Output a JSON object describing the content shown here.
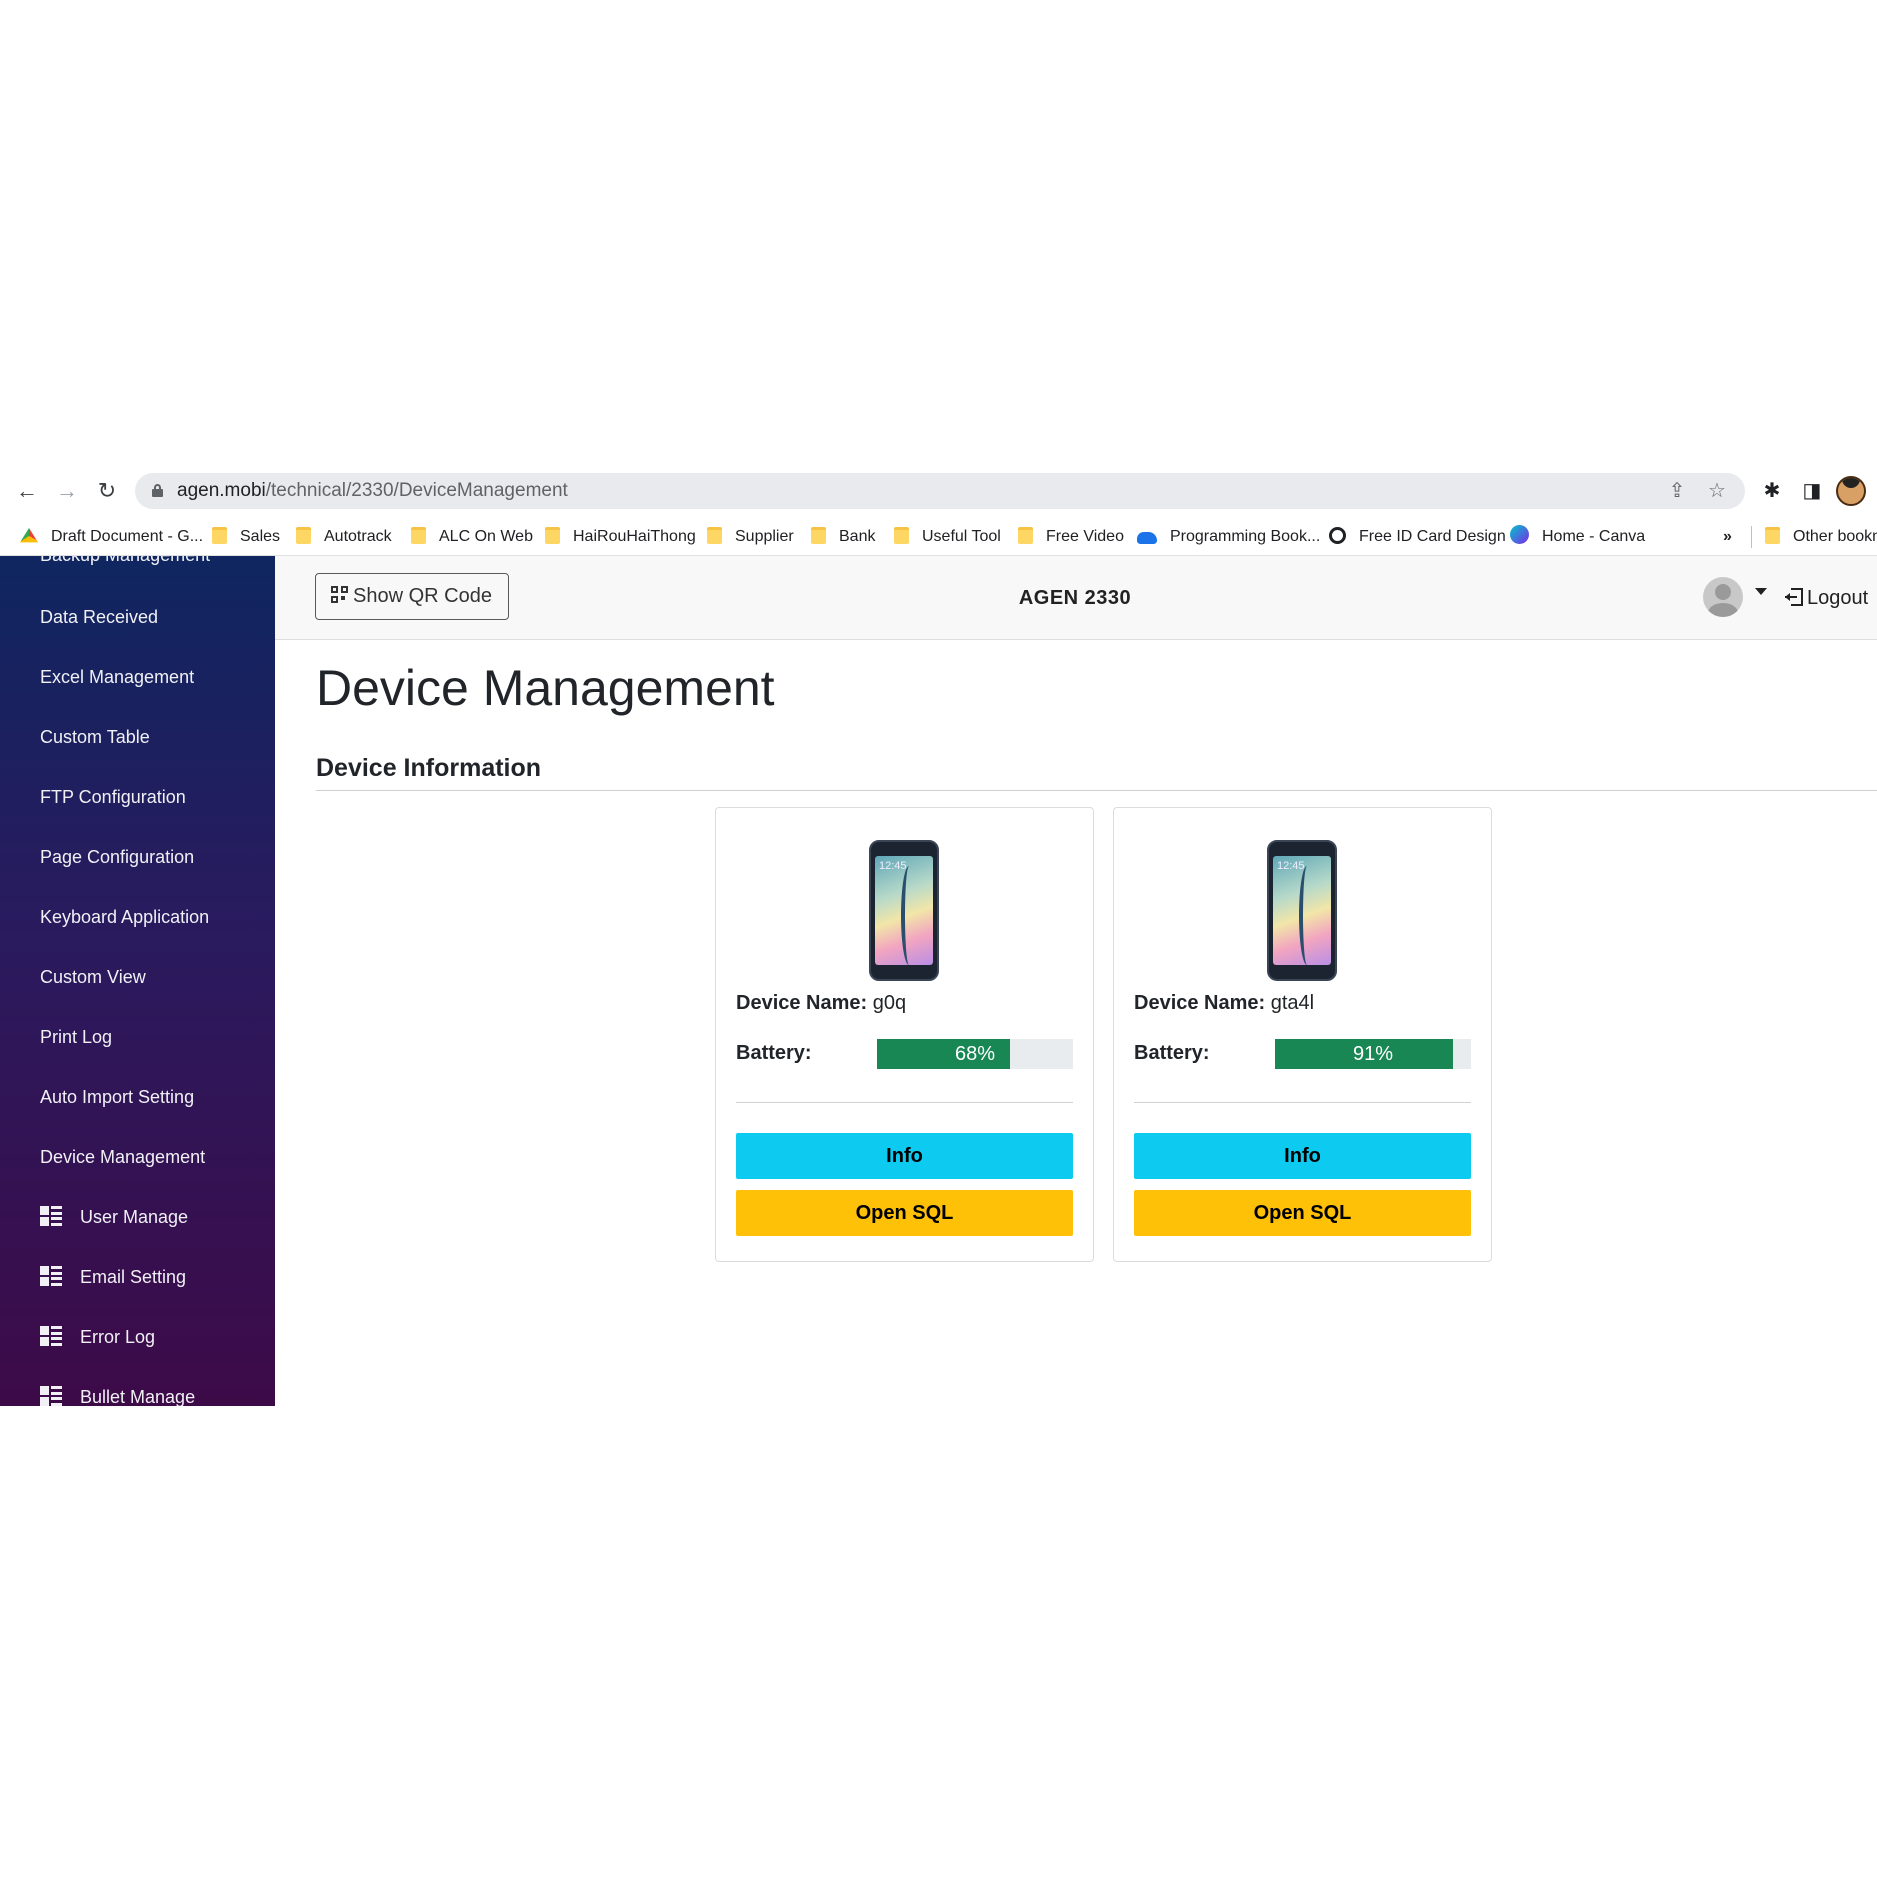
{
  "browser": {
    "url_host": "agen.mobi",
    "url_path": "/technical/2330/DeviceManagement",
    "bookmarks": [
      "Draft Document - G...",
      "Sales",
      "Autotrack",
      "ALC On Web",
      "HaiRouHaiThong",
      "Supplier",
      "Bank",
      "Useful Tool",
      "Free Video",
      "Programming Book...",
      "Free ID Card Design",
      "Home - Canva"
    ],
    "more_bookmarks": "»",
    "other_bookmarks": "Other bookm"
  },
  "sidebar": {
    "items": [
      "Backup Management",
      "Data Received",
      "Excel Management",
      "Custom Table",
      "FTP Configuration",
      "Page Configuration",
      "Keyboard Application",
      "Custom View",
      "Print Log",
      "Auto Import Setting",
      "Device Management",
      "User Manage",
      "Email Setting",
      "Error Log",
      "Bullet Manage"
    ]
  },
  "topbar": {
    "qr_button": "Show QR Code",
    "title": "AGEN 2330",
    "logout": "Logout"
  },
  "main": {
    "page_title": "Device Management",
    "section_title": "Device Information",
    "devices": [
      {
        "name_label": "Device Name:",
        "name": "g0q",
        "battery_label": "Battery:",
        "battery_percent": 68,
        "battery_text": "68%",
        "info_button": "Info",
        "sql_button": "Open SQL",
        "phone_time": "12:45"
      },
      {
        "name_label": "Device Name:",
        "name": "gta4l",
        "battery_label": "Battery:",
        "battery_percent": 91,
        "battery_text": "91%",
        "info_button": "Info",
        "sql_button": "Open SQL",
        "phone_time": "12:45"
      }
    ]
  },
  "colors": {
    "battery_fill": "#198754",
    "info_button": "#0dcaf0",
    "sql_button": "#ffc107",
    "sidebar_top": "#0f2660",
    "sidebar_bottom": "#3d0a48"
  }
}
